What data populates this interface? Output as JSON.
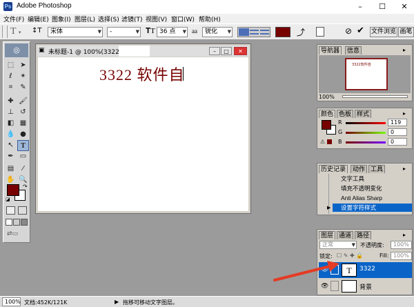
{
  "titlebar": {
    "title": "Adobe Photoshop"
  },
  "menu": [
    "文件(F)",
    "编辑(E)",
    "图象(I)",
    "图层(L)",
    "选择(S)",
    "滤镜(T)",
    "视图(V)",
    "窗口(W)",
    "帮助(H)"
  ],
  "options": {
    "font_family": "宋体",
    "font_style": "-",
    "font_size": "36 点",
    "aa_label": "a",
    "aa_value": "锐化",
    "file_browser_tab": "文件浏览",
    "brush_tab": "画笔"
  },
  "colors": {
    "foreground": "#770000",
    "background": "#ffffff",
    "highlight": "#0a64c8"
  },
  "document": {
    "title": "未标题-1 @ 100%(3322",
    "canvas_text": "3322 软件自"
  },
  "navigator": {
    "tabs": [
      "导航器",
      "信息"
    ],
    "zoom": "100%",
    "thumb_text": "3322软件自"
  },
  "color_panel": {
    "tabs": [
      "颜色",
      "色板",
      "样式"
    ],
    "r_label": "R",
    "r_value": "119",
    "g_label": "G",
    "g_value": "0",
    "b_label": "B",
    "b_value": "0"
  },
  "history": {
    "tabs": [
      "历史记录",
      "动作",
      "工具"
    ],
    "items": [
      "文字工具",
      "填充不透明变化",
      "Anti Alias Sharp",
      "设置字符样式"
    ]
  },
  "layers": {
    "tabs": [
      "图层",
      "通道",
      "路径"
    ],
    "blend_mode": "正常",
    "opacity_label": "不透明度:",
    "opacity_value": "100%",
    "lock_label": "锁定:",
    "fill_label": "Fill:",
    "fill_value": "100%",
    "layer_text_name": "3322",
    "layer_text_thumb": "T",
    "layer_bg_name": "背景"
  },
  "status": {
    "zoom": "100%",
    "doc_info": "文档:452K/121K",
    "hint": "拖移可移动文字图层。"
  }
}
